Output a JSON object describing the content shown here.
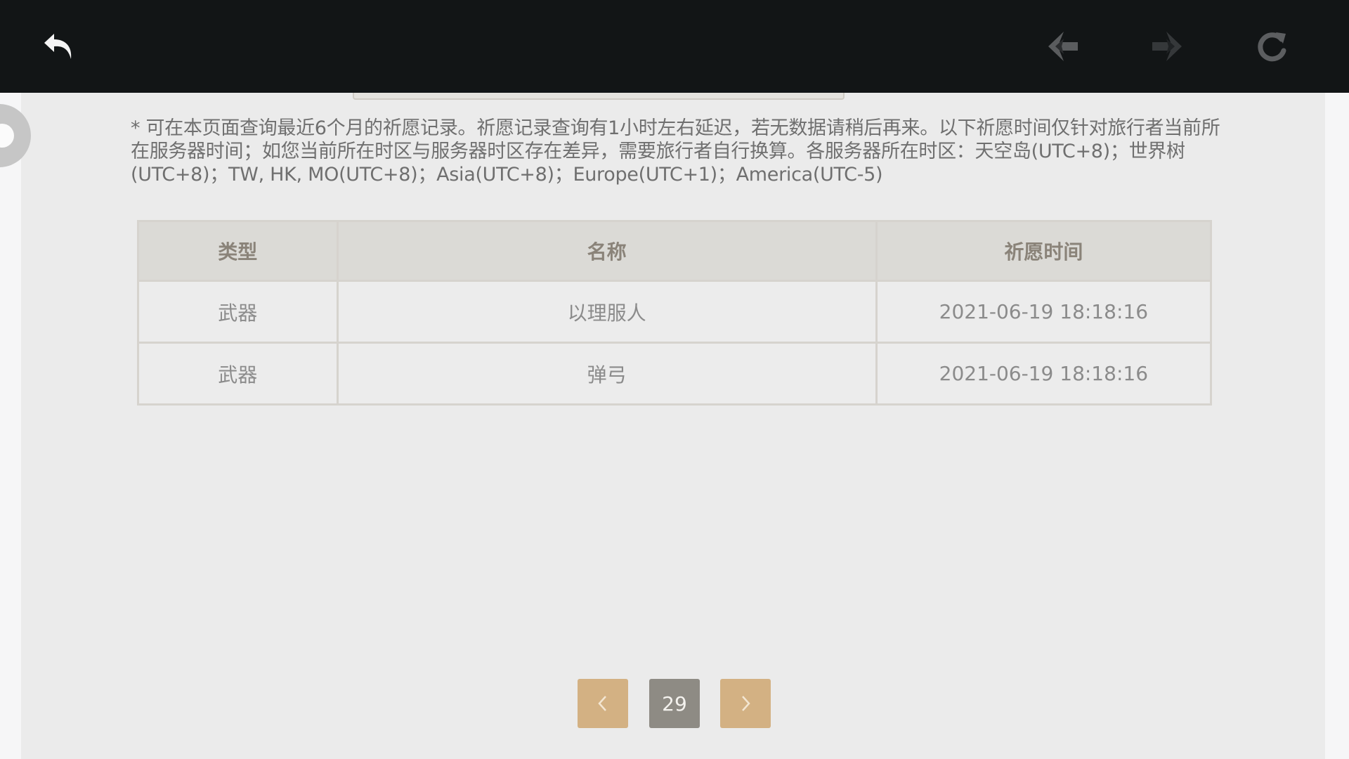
{
  "toolbar": {
    "back_icon": "back-arrow-icon",
    "prev_icon": "nav-prev-icon",
    "next_icon": "nav-next-icon",
    "refresh_icon": "refresh-icon"
  },
  "notice": "* 可在本页面查询最近6个月的祈愿记录。祈愿记录查询有1小时左右延迟，若无数据请稍后再来。以下祈愿时间仅针对旅行者当前所在服务器时间；如您当前所在时区与服务器时区存在差异，需要旅行者自行换算。各服务器所在时区：天空岛(UTC+8)；世界树(UTC+8)；TW, HK, MO(UTC+8)；Asia(UTC+8)；Europe(UTC+1)；America(UTC-5)",
  "table": {
    "headers": [
      "类型",
      "名称",
      "祈愿时间"
    ],
    "rows": [
      [
        "武器",
        "以理服人",
        "2021-06-19 18:18:16"
      ],
      [
        "武器",
        "弹弓",
        "2021-06-19 18:18:16"
      ]
    ]
  },
  "pagination": {
    "current_page": "29",
    "prev_icon": "chevron-left-icon",
    "next_icon": "chevron-right-icon"
  },
  "colors": {
    "topbar": "#121516",
    "background": "#ebebeb",
    "header_bg": "#dbdad6",
    "accent_button": "#d3b183",
    "current_page_bg": "#8e8b84"
  }
}
